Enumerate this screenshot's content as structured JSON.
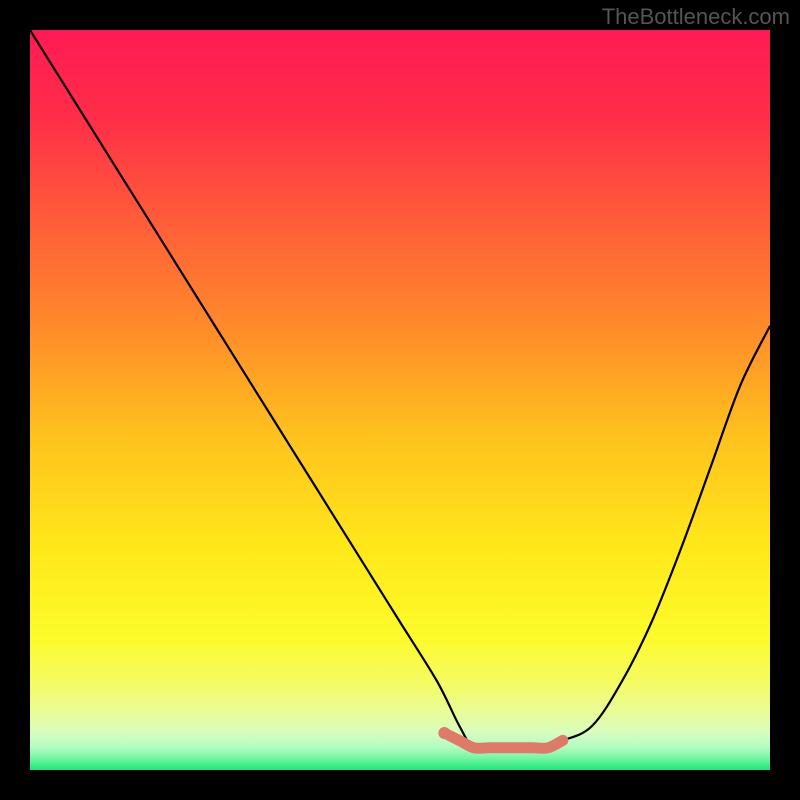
{
  "watermark": "TheBottleneck.com",
  "chart_data": {
    "type": "line",
    "title": "",
    "xlabel": "",
    "ylabel": "",
    "xlim": [
      0,
      100
    ],
    "ylim": [
      0,
      100
    ],
    "gradient_stops": [
      {
        "offset": 0,
        "color": "#ff1a55"
      },
      {
        "offset": 12,
        "color": "#ff2e48"
      },
      {
        "offset": 25,
        "color": "#ff5a3a"
      },
      {
        "offset": 40,
        "color": "#ff8a2a"
      },
      {
        "offset": 55,
        "color": "#ffc21e"
      },
      {
        "offset": 70,
        "color": "#ffe81a"
      },
      {
        "offset": 82,
        "color": "#fdfb2a"
      },
      {
        "offset": 88,
        "color": "#f5fb60"
      },
      {
        "offset": 92,
        "color": "#eafc95"
      },
      {
        "offset": 95,
        "color": "#d7fdc0"
      },
      {
        "offset": 97,
        "color": "#b0fcc0"
      },
      {
        "offset": 98.5,
        "color": "#6ef5a0"
      },
      {
        "offset": 100,
        "color": "#1ee67a"
      }
    ],
    "series": [
      {
        "name": "bottleneck-curve",
        "color": "#000000",
        "x": [
          0,
          5,
          10,
          15,
          20,
          25,
          30,
          35,
          40,
          45,
          50,
          55,
          58,
          60,
          63,
          66,
          68,
          72,
          76,
          80,
          84,
          88,
          92,
          96,
          100
        ],
        "values": [
          100,
          92,
          84,
          76,
          68,
          60,
          52,
          44,
          36,
          28,
          20,
          12,
          6,
          3,
          3,
          3,
          3,
          4,
          6,
          12,
          20,
          30,
          41,
          52,
          60
        ]
      },
      {
        "name": "sweet-spot-band",
        "color": "#e07a68",
        "x": [
          56,
          58,
          60,
          62,
          64,
          66,
          68,
          70,
          72
        ],
        "values": [
          5,
          4,
          3,
          3,
          3,
          3,
          3,
          3,
          4
        ]
      }
    ],
    "marker": {
      "x": 56,
      "y": 5,
      "color": "#e07a68"
    }
  }
}
